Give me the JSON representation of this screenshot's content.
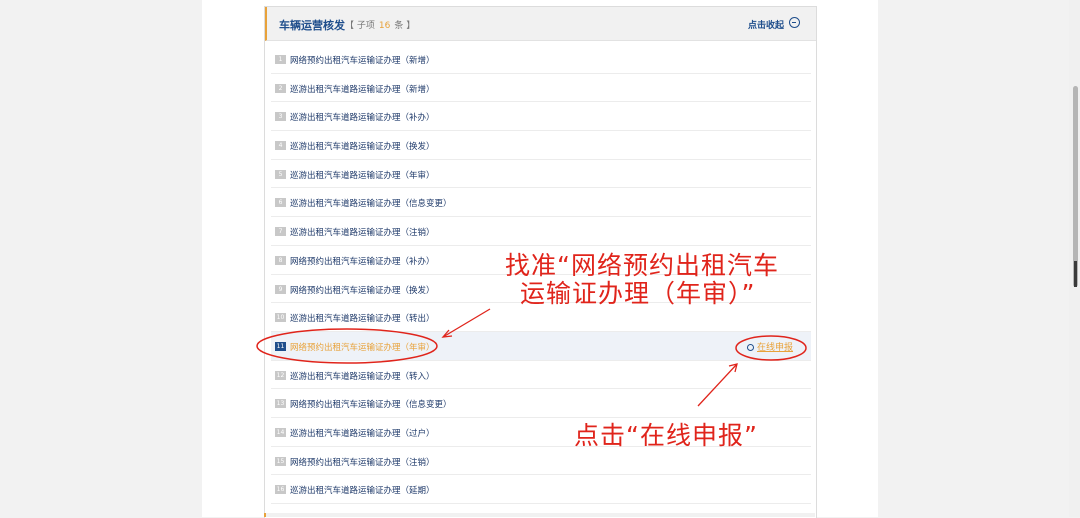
{
  "panel": {
    "title": "车辆运营核发",
    "count_prefix": "【 子项",
    "count": "16",
    "count_suffix": "条 】",
    "collapse_label": "点击收起"
  },
  "items": [
    {
      "num": "1",
      "label": "网络预约出租汽车运输证办理（新增）"
    },
    {
      "num": "2",
      "label": "巡游出租汽车道路运输证办理（新增）"
    },
    {
      "num": "3",
      "label": "巡游出租汽车道路运输证办理（补办）"
    },
    {
      "num": "4",
      "label": "巡游出租汽车道路运输证办理（换发）"
    },
    {
      "num": "5",
      "label": "巡游出租汽车道路运输证办理（年审）"
    },
    {
      "num": "6",
      "label": "巡游出租汽车道路运输证办理（信息变更）"
    },
    {
      "num": "7",
      "label": "巡游出租汽车道路运输证办理（注销）"
    },
    {
      "num": "8",
      "label": "网络预约出租汽车运输证办理（补办）"
    },
    {
      "num": "9",
      "label": "网络预约出租汽车运输证办理（换发）"
    },
    {
      "num": "10",
      "label": "巡游出租汽车道路运输证办理（转出）"
    },
    {
      "num": "11",
      "label": "网络预约出租汽车运输证办理（年审）",
      "highlight": true
    },
    {
      "num": "12",
      "label": "巡游出租汽车道路运输证办理（转入）"
    },
    {
      "num": "13",
      "label": "网络预约出租汽车运输证办理（信息变更）"
    },
    {
      "num": "14",
      "label": "巡游出租汽车道路运输证办理（过户）"
    },
    {
      "num": "15",
      "label": "网络预约出租汽车运输证办理（注销）"
    },
    {
      "num": "16",
      "label": "巡游出租汽车道路运输证办理（延期）"
    }
  ],
  "apply_label": "在线申报",
  "annotations": {
    "find_line1": "找准“网络预约出租汽车",
    "find_line2": "运输证办理（年审）”",
    "click_hint": "点击“在线申报”"
  },
  "colors": {
    "accent": "#e8a23a",
    "link": "#1f4e8c",
    "annotation": "#e0241b"
  }
}
